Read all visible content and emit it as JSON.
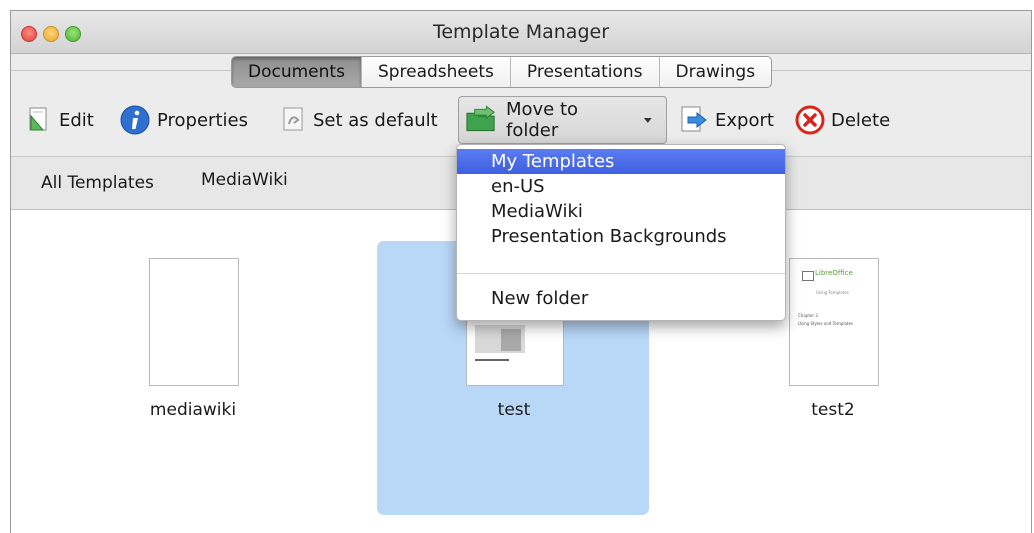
{
  "window": {
    "title": "Template Manager"
  },
  "tabs": [
    {
      "label": "Documents",
      "active": true
    },
    {
      "label": "Spreadsheets",
      "active": false
    },
    {
      "label": "Presentations",
      "active": false
    },
    {
      "label": "Drawings",
      "active": false
    }
  ],
  "toolbar": {
    "edit": "Edit",
    "properties": "Properties",
    "set_default": "Set as default",
    "move_to_folder": "Move to folder",
    "export": "Export",
    "delete": "Delete"
  },
  "filters": [
    "All Templates",
    "MediaWiki"
  ],
  "templates": [
    {
      "name": "mediawiki"
    },
    {
      "name": "test",
      "selected": true
    },
    {
      "name": "test2"
    }
  ],
  "thumbnail_text": {
    "logo": "LibreOffice",
    "subtitle": "Using Templates",
    "chapter": "Chapter 3",
    "chapter_title": "Using Styles and Templates"
  },
  "folder_menu": {
    "items": [
      "My Templates",
      "en-US",
      "MediaWiki",
      "Presentation Backgrounds"
    ],
    "highlighted": "My Templates",
    "new_folder": "New folder"
  },
  "colors": {
    "selection": "#b9d7f7",
    "menu_highlight": "#4a6ae6",
    "delete_red": "#d9261c",
    "info_blue": "#2f6fcf"
  }
}
